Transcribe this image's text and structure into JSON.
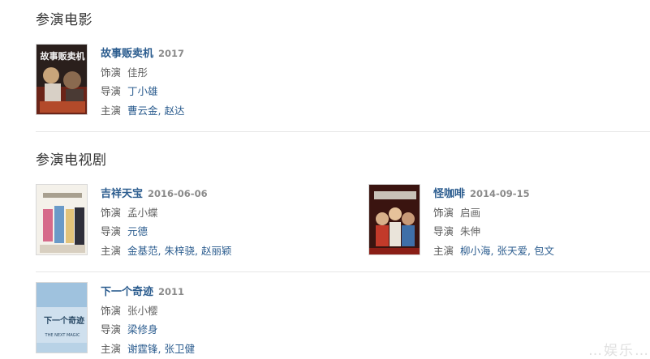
{
  "movies_section": {
    "title": "参演电影",
    "items": [
      {
        "title": "故事贩卖机",
        "year": "2017",
        "role_label": "饰演",
        "role": "佳彤",
        "director_label": "导演",
        "director": "丁小雄",
        "cast_label": "主演",
        "cast": [
          "曹云金",
          "赵达"
        ],
        "poster_text": "故事贩卖机"
      }
    ]
  },
  "tv_section": {
    "title": "参演电视剧",
    "items": [
      {
        "title": "吉祥天宝",
        "date": "2016-06-06",
        "role_label": "饰演",
        "role": "孟小蝶",
        "director_label": "导演",
        "director": "元德",
        "cast_label": "主演",
        "cast": [
          "金基范",
          "朱梓骁",
          "赵丽颖"
        ]
      },
      {
        "title": "怪咖啡",
        "date": "2014-09-15",
        "role_label": "饰演",
        "role": "启画",
        "director_label": "导演",
        "director": "朱伸",
        "cast_label": "主演",
        "cast": [
          "柳小海",
          "张天爱",
          "包文"
        ]
      },
      {
        "title": "下一个奇迹",
        "date": "2011",
        "role_label": "饰演",
        "role": "张小樱",
        "director_label": "导演",
        "director": "梁修身",
        "cast_label": "主演",
        "cast": [
          "谢霆锋",
          "张卫健"
        ],
        "poster_text": "下一个奇迹",
        "poster_subtext": "THE NEXT MAGIC"
      }
    ]
  },
  "separator": ",",
  "watermark": "…娱乐…"
}
